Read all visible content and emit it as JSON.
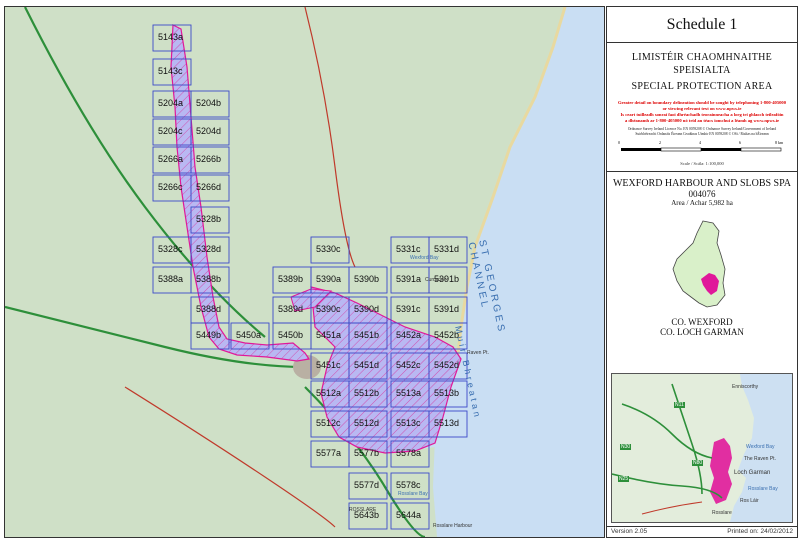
{
  "panel": {
    "schedule": "Schedule 1",
    "irish_heading_1": "LIMISTÉIR CHAOMHNAITHE",
    "irish_heading_2": "SPEISIALTA",
    "english_heading": "SPECIAL PROTECTION AREA",
    "warning_lines": [
      "Greater detail on boundary delineation should be sought by telephoning 1-800-405000",
      "or viewing relevant text on www.npws.ie",
      "Is ceart tuilleadh sonraí faoi dhréachadh teorainneacha a lorg trí ghlaoch teileafóin",
      "a dhéanamh ar 1-800-405000 nó tríd an téacs iomchuí a léamh ag www.npws.ie"
    ],
    "licence_lines": [
      "Ordnance Survey Ireland Licence No. EN 0059208 © Ordnance Survey Ireland/Government of Ireland",
      "Suirbhéireacht Ordanáis Éireann Ceadúnas Uimhir EN 0059208 © OSi / Rialtas na hÉireann"
    ],
    "scale_ticks": [
      "0",
      "2",
      "4",
      "6",
      "8 km"
    ],
    "scale_text": "Scale / Scála: 1:100,000",
    "site_name": "WEXFORD HARBOUR AND SLOBS SPA",
    "site_code": "004076",
    "area": "Area / Achar 5,982 ha",
    "county_en": "CO. WEXFORD",
    "county_ga": "CO. LOCH GARMAN",
    "version": "Version 2.05",
    "printed": "Printed on: 24/02/2012"
  },
  "map": {
    "sea_label_1": "ST GEORGES CHANNEL",
    "sea_label_2": "Muir Bhreatan",
    "places": [
      "Wexford Bay",
      "Raven Pt.",
      "Rosslare Bay",
      "ROSSLARE",
      "Rosslare Harbour",
      "Curracloe"
    ],
    "sheets": [
      "5143a",
      "5143c",
      "5204a",
      "5204b",
      "5204c",
      "5204d",
      "5266a",
      "5266b",
      "5266c",
      "5266d",
      "5328b",
      "5328c",
      "5328d",
      "5388a",
      "5388b",
      "5388d",
      "5389b",
      "5389d",
      "5330c",
      "5331c",
      "5331d",
      "5390a",
      "5390b",
      "5391a",
      "5391b",
      "5390c",
      "5390d",
      "5391c",
      "5391d",
      "5449b",
      "5450a",
      "5450b",
      "5451a",
      "5451b",
      "5452a",
      "5452b",
      "5451c",
      "5451d",
      "5452c",
      "5452d",
      "5512a",
      "5512b",
      "5513a",
      "5513b",
      "5512c",
      "5512d",
      "5513c",
      "5513d",
      "5577a",
      "5577b",
      "5578a",
      "5577d",
      "5578c",
      "5643b",
      "5644a"
    ],
    "colors": {
      "land": "#cfe0c7",
      "sea": "#c9def3",
      "spa_fill": "#b9b8f2",
      "spa_outline": "#e0189a",
      "grid": "#3b49c8"
    }
  },
  "locator": {
    "places": [
      "Enniscorthy",
      "Wexford Bay",
      "The Raven Pt.",
      "Loch Garman",
      "Rosslare Bay",
      "Ros Láir",
      "Rosslare"
    ],
    "roads": [
      "N11",
      "N30",
      "N25",
      "N80"
    ]
  }
}
